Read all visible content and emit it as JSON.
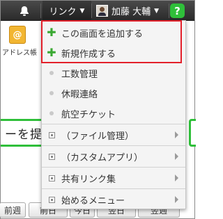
{
  "header": {
    "links_label": "リンク",
    "user_name": "加藤 大輔",
    "help_label": "?"
  },
  "background": {
    "app_label": "アドレス帳",
    "banner_text": "ーを提",
    "nav_buttons": [
      "前週",
      "前日",
      "今日",
      "翌日",
      "翌週"
    ]
  },
  "menu": {
    "add_screen": "この画面を追加する",
    "create_new": "新規作成する",
    "links": [
      "工数管理",
      "休暇連絡",
      "航空チケット"
    ],
    "folders": [
      "（ファイル管理）",
      "（カスタムアプリ）"
    ],
    "shared_links": "共有リンク集",
    "getting_started": "始めるメニュー"
  },
  "colors": {
    "header_bg": "#2b2b2b",
    "accent_green": "#2fbf3a",
    "highlight_red": "#e3202a"
  }
}
